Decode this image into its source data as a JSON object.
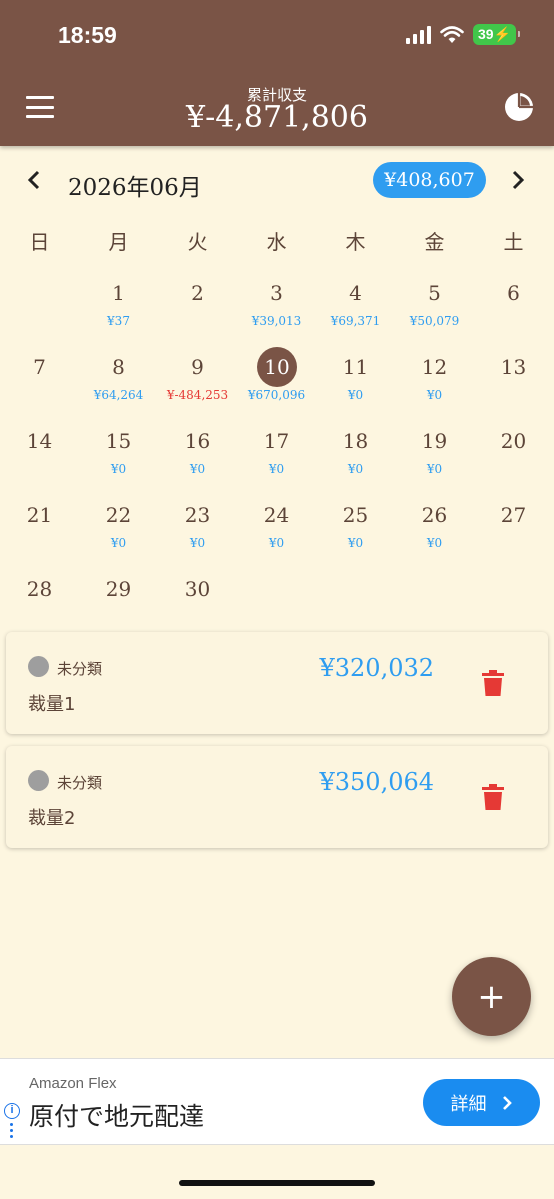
{
  "status": {
    "time": "18:59",
    "battery": "39"
  },
  "header": {
    "label": "累計収支",
    "total": "¥-4,871,806",
    "menu_icon": "hamburger-icon",
    "chart_icon": "pie-chart-icon"
  },
  "month": {
    "title": "2026年06月",
    "total": "¥408,607",
    "prev": "‹",
    "next": "›"
  },
  "weekdays": [
    "日",
    "月",
    "火",
    "水",
    "木",
    "金",
    "土"
  ],
  "calendar": {
    "first_weekday": 1,
    "days": [
      {
        "day": "1",
        "amount": "¥37"
      },
      {
        "day": "2",
        "amount": ""
      },
      {
        "day": "3",
        "amount": "¥39,013"
      },
      {
        "day": "4",
        "amount": "¥69,371"
      },
      {
        "day": "5",
        "amount": "¥50,079"
      },
      {
        "day": "6",
        "amount": ""
      },
      {
        "day": "7",
        "amount": ""
      },
      {
        "day": "8",
        "amount": "¥64,264"
      },
      {
        "day": "9",
        "amount": "¥-484,253",
        "negative": true
      },
      {
        "day": "10",
        "amount": "¥670,096",
        "selected": true
      },
      {
        "day": "11",
        "amount": "¥0"
      },
      {
        "day": "12",
        "amount": "¥0"
      },
      {
        "day": "13",
        "amount": ""
      },
      {
        "day": "14",
        "amount": ""
      },
      {
        "day": "15",
        "amount": "¥0"
      },
      {
        "day": "16",
        "amount": "¥0"
      },
      {
        "day": "17",
        "amount": "¥0"
      },
      {
        "day": "18",
        "amount": "¥0"
      },
      {
        "day": "19",
        "amount": "¥0"
      },
      {
        "day": "20",
        "amount": ""
      },
      {
        "day": "21",
        "amount": ""
      },
      {
        "day": "22",
        "amount": "¥0"
      },
      {
        "day": "23",
        "amount": "¥0"
      },
      {
        "day": "24",
        "amount": "¥0"
      },
      {
        "day": "25",
        "amount": "¥0"
      },
      {
        "day": "26",
        "amount": "¥0"
      },
      {
        "day": "27",
        "amount": ""
      },
      {
        "day": "28",
        "amount": ""
      },
      {
        "day": "29",
        "amount": ""
      },
      {
        "day": "30",
        "amount": ""
      }
    ]
  },
  "transactions": [
    {
      "category": "未分類",
      "title": "裁量1",
      "amount": "¥320,032"
    },
    {
      "category": "未分類",
      "title": "裁量2",
      "amount": "¥350,064"
    }
  ],
  "fab": {
    "label": "+"
  },
  "ad": {
    "brand": "Amazon Flex",
    "headline": "原付で地元配達",
    "cta": "詳細"
  },
  "colors": {
    "header": "#7a5446",
    "background": "#fdf6e0",
    "accent": "#2f9df0",
    "negative": "#e53935"
  }
}
